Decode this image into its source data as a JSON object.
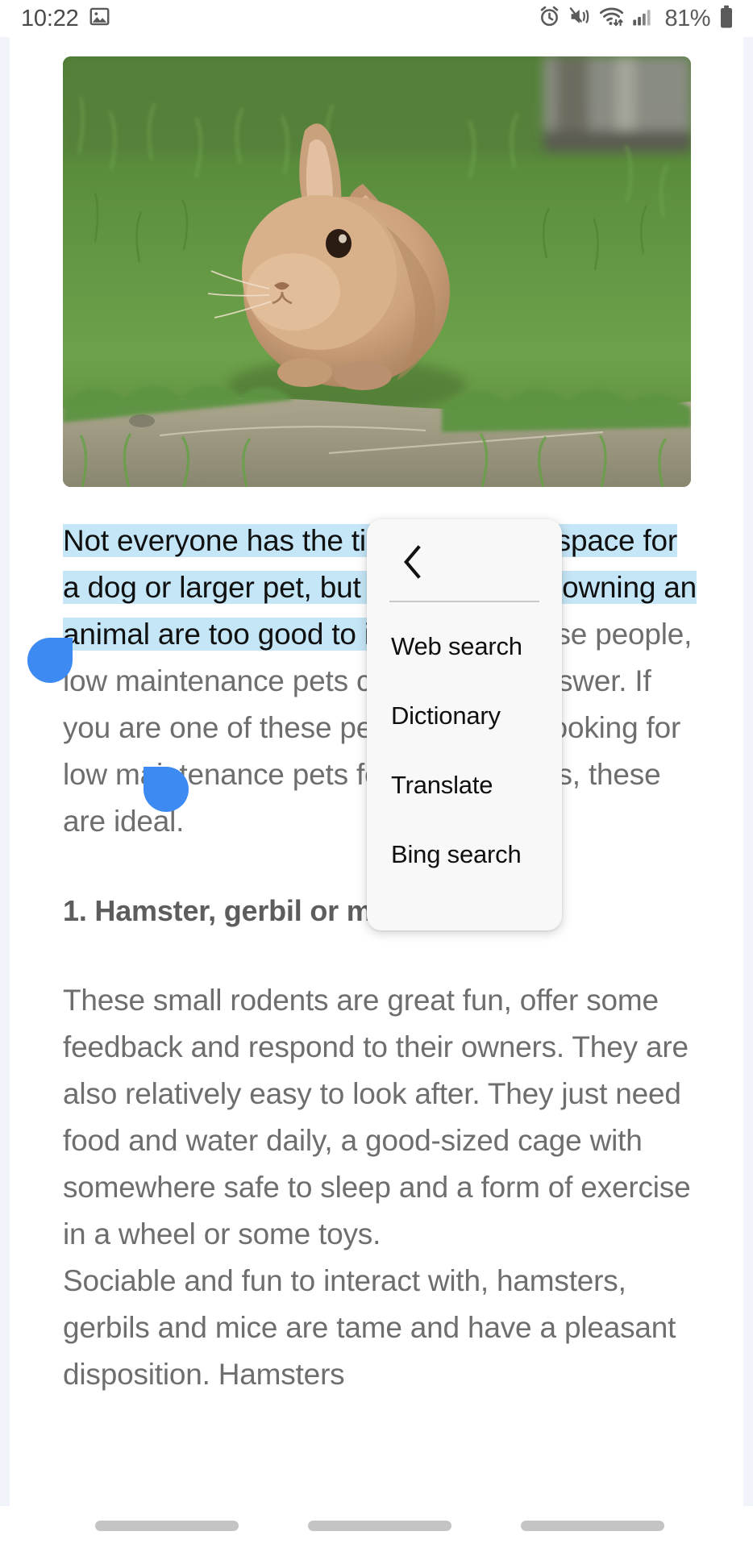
{
  "status_bar": {
    "time": "10:22",
    "battery_percent": "81%",
    "icons": {
      "notification": "image-icon",
      "alarm": "alarm-icon",
      "sound": "mute-vibrate-icon",
      "wifi": "wifi-icon",
      "signal": "cellular-signal-icon",
      "battery": "battery-icon"
    }
  },
  "hero": {
    "alt": "rabbit-photo",
    "description": "Light brown rabbit sitting on green grass"
  },
  "article": {
    "paragraph1_selected": "Not everyone has the time, energy or space for a dog or larger pet, but the benefits of owning an animal are too good to ignore.",
    "paragraph1_rest": " For those people, low maintenance pets could be the answer. If you are one of these people and are looking for low maintenance pets for kids or adults, these are ideal.",
    "heading1": "1. Hamster, gerbil or mice",
    "paragraph2": "These small rodents are great fun, offer some feedback and respond to their owners. They are also relatively easy to look after. They just need food and water daily, a good-sized cage with somewhere safe to sleep and a form of exercise in a wheel or some toys.",
    "paragraph3": "Sociable and fun to interact with, hamsters, gerbils and mice are tame and have a pleasant disposition. Hamsters"
  },
  "selection": {
    "highlight_color": "#c5e6f7",
    "handle_color": "#3d8bf2",
    "start_handle": "selection-start-handle",
    "end_handle": "selection-end-handle"
  },
  "context_menu": {
    "back_icon": "chevron-left-icon",
    "items": [
      {
        "label": "Web search"
      },
      {
        "label": "Dictionary"
      },
      {
        "label": "Translate"
      },
      {
        "label": "Bing search"
      }
    ]
  },
  "nav_bar": {
    "pills": [
      "recents-pill",
      "home-pill",
      "back-pill"
    ]
  },
  "colors": {
    "accent": "#3d8bf2",
    "selection": "#c5e6f7",
    "body_text": "#6e6e6e",
    "menu_bg": "#f8f8f8"
  }
}
